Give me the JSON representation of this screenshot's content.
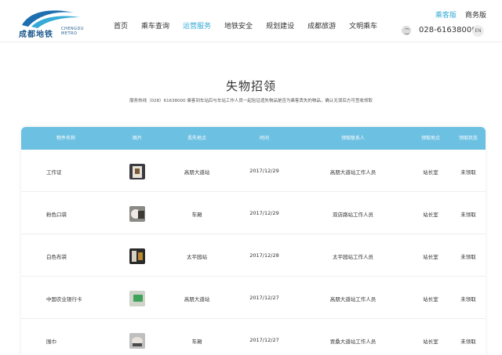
{
  "header": {
    "logo": {
      "cn": "成都地铁",
      "en": "CHENGDU METRO"
    },
    "nav": [
      "首页",
      "乘车查询",
      "运营服务",
      "地铁安全",
      "规划建设",
      "成都旅游",
      "文明乘车"
    ],
    "active_nav": "运营服务",
    "versions": {
      "passenger": "乘客版",
      "business": "商务版"
    },
    "phone": "028-61638000",
    "lang": "EN"
  },
  "page": {
    "title": "失物招领",
    "subtitle": "服务热线（028）61638000 乘客到车站后与车站工作人员一起验证遗失物品是否为乘客丢失的物品，确认无误后方可签收领取"
  },
  "table": {
    "headers": [
      "物件名称",
      "图片",
      "丢失地点",
      "时间",
      "领取联系人",
      "领取地点",
      "领取状态"
    ],
    "rows": [
      {
        "name": "工作证",
        "image": "badge-photo",
        "location": "高朋大道站",
        "date": "2017/12/29",
        "contact": "高朋大道站工作人员",
        "pickup": "站长室",
        "status": "未领取"
      },
      {
        "name": "粉色口袋",
        "image": "pouch-photo",
        "location": "车厢",
        "date": "2017/12/29",
        "contact": "双店路站工作人员",
        "pickup": "站长室",
        "status": "未领取"
      },
      {
        "name": "白色布袋",
        "image": "bag-photo",
        "location": "太平园站",
        "date": "2017/12/28",
        "contact": "太平园站工作人员",
        "pickup": "站长室",
        "status": "未领取"
      },
      {
        "name": "中国农业银行卡",
        "image": "card-photo",
        "location": "高朋大道站",
        "date": "2017/12/27",
        "contact": "高朋大道站工作人员",
        "pickup": "站长室",
        "status": "未领取"
      },
      {
        "name": "围巾",
        "image": "scarf-photo",
        "location": "车厢",
        "date": "2017/12/27",
        "contact": "贾桑大道站工作人员",
        "pickup": "站长室",
        "status": "未领取"
      }
    ]
  },
  "colors": {
    "accent": "#35aad6",
    "table_header": "#6cc0e2",
    "logo": "#1d5a8f"
  }
}
